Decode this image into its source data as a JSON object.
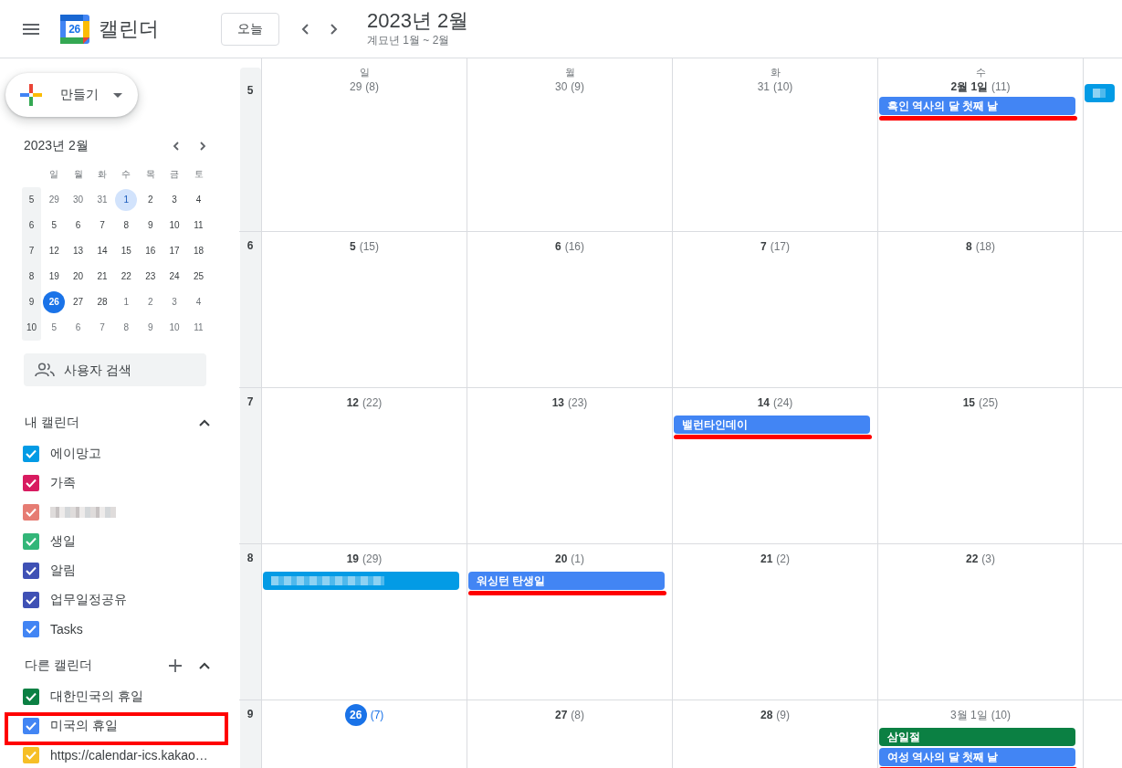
{
  "header": {
    "title": "캘린더",
    "logo_day": "26",
    "today_button": "오늘",
    "month_title": "2023년 2월",
    "lunar_subtitle": "계묘년 1월 ~ 2월"
  },
  "sidebar": {
    "create_button": "만들기",
    "mini_calendar": {
      "title": "2023년 2월",
      "weekdays": [
        "일",
        "월",
        "화",
        "수",
        "목",
        "금",
        "토"
      ],
      "weeks": [
        {
          "number": "5",
          "days": [
            {
              "label": "29",
              "outside": true,
              "today": false,
              "selected": false
            },
            {
              "label": "30",
              "outside": true,
              "today": false,
              "selected": false
            },
            {
              "label": "31",
              "outside": true,
              "today": false,
              "selected": false
            },
            {
              "label": "1",
              "outside": false,
              "today": false,
              "selected": true
            },
            {
              "label": "2",
              "outside": false,
              "today": false,
              "selected": false
            },
            {
              "label": "3",
              "outside": false,
              "today": false,
              "selected": false
            },
            {
              "label": "4",
              "outside": false,
              "today": false,
              "selected": false
            }
          ]
        },
        {
          "number": "6",
          "days": [
            {
              "label": "5",
              "outside": false,
              "today": false,
              "selected": false
            },
            {
              "label": "6",
              "outside": false,
              "today": false,
              "selected": false
            },
            {
              "label": "7",
              "outside": false,
              "today": false,
              "selected": false
            },
            {
              "label": "8",
              "outside": false,
              "today": false,
              "selected": false
            },
            {
              "label": "9",
              "outside": false,
              "today": false,
              "selected": false
            },
            {
              "label": "10",
              "outside": false,
              "today": false,
              "selected": false
            },
            {
              "label": "11",
              "outside": false,
              "today": false,
              "selected": false
            }
          ]
        },
        {
          "number": "7",
          "days": [
            {
              "label": "12",
              "outside": false,
              "today": false,
              "selected": false
            },
            {
              "label": "13",
              "outside": false,
              "today": false,
              "selected": false
            },
            {
              "label": "14",
              "outside": false,
              "today": false,
              "selected": false
            },
            {
              "label": "15",
              "outside": false,
              "today": false,
              "selected": false
            },
            {
              "label": "16",
              "outside": false,
              "today": false,
              "selected": false
            },
            {
              "label": "17",
              "outside": false,
              "today": false,
              "selected": false
            },
            {
              "label": "18",
              "outside": false,
              "today": false,
              "selected": false
            }
          ]
        },
        {
          "number": "8",
          "days": [
            {
              "label": "19",
              "outside": false,
              "today": false,
              "selected": false
            },
            {
              "label": "20",
              "outside": false,
              "today": false,
              "selected": false
            },
            {
              "label": "21",
              "outside": false,
              "today": false,
              "selected": false
            },
            {
              "label": "22",
              "outside": false,
              "today": false,
              "selected": false
            },
            {
              "label": "23",
              "outside": false,
              "today": false,
              "selected": false
            },
            {
              "label": "24",
              "outside": false,
              "today": false,
              "selected": false
            },
            {
              "label": "25",
              "outside": false,
              "today": false,
              "selected": false
            }
          ]
        },
        {
          "number": "9",
          "days": [
            {
              "label": "26",
              "outside": false,
              "today": true,
              "selected": false
            },
            {
              "label": "27",
              "outside": false,
              "today": false,
              "selected": false
            },
            {
              "label": "28",
              "outside": false,
              "today": false,
              "selected": false
            },
            {
              "label": "1",
              "outside": true,
              "today": false,
              "selected": false
            },
            {
              "label": "2",
              "outside": true,
              "today": false,
              "selected": false
            },
            {
              "label": "3",
              "outside": true,
              "today": false,
              "selected": false
            },
            {
              "label": "4",
              "outside": true,
              "today": false,
              "selected": false
            }
          ]
        },
        {
          "number": "10",
          "days": [
            {
              "label": "5",
              "outside": true,
              "today": false,
              "selected": false
            },
            {
              "label": "6",
              "outside": true,
              "today": false,
              "selected": false
            },
            {
              "label": "7",
              "outside": true,
              "today": false,
              "selected": false
            },
            {
              "label": "8",
              "outside": true,
              "today": false,
              "selected": false
            },
            {
              "label": "9",
              "outside": true,
              "today": false,
              "selected": false
            },
            {
              "label": "10",
              "outside": true,
              "today": false,
              "selected": false
            },
            {
              "label": "11",
              "outside": true,
              "today": false,
              "selected": false
            }
          ]
        }
      ]
    },
    "people_search": {
      "placeholder": "사용자 검색"
    },
    "calendar_groups": [
      {
        "title": "내 캘린더",
        "expanded": true,
        "addable": false,
        "items": [
          {
            "label": "에이망고",
            "color": "#039be5",
            "checked": true,
            "outlined": false
          },
          {
            "label": "가족",
            "color": "#d81b60",
            "checked": true,
            "outlined": false
          },
          {
            "redacted": true,
            "color": "#e67c73",
            "checked": true,
            "outlined": false
          },
          {
            "label": "생일",
            "color": "#33b679",
            "checked": true,
            "outlined": false
          },
          {
            "label": "알림",
            "color": "#3f51b5",
            "checked": true,
            "outlined": false
          },
          {
            "label": "업무일정공유",
            "color": "#3f51b5",
            "checked": true,
            "outlined": false
          },
          {
            "label": "Tasks",
            "color": "#4285f4",
            "checked": true,
            "outlined": false
          }
        ]
      },
      {
        "title": "다른 캘린더",
        "expanded": true,
        "addable": true,
        "items": [
          {
            "label": "대한민국의 휴일",
            "color": "#0b8043",
            "checked": true,
            "outlined": false
          },
          {
            "label": "미국의 휴일",
            "color": "#4285f4",
            "checked": true,
            "outlined": true
          },
          {
            "label": "https://calendar-ics.kakao…",
            "color": "#f6bf26",
            "checked": true,
            "outlined": false
          }
        ]
      }
    ]
  },
  "month": {
    "weekdays": [
      "일",
      "월",
      "화",
      "수"
    ],
    "weeks": [
      {
        "number": "5",
        "days": [
          {
            "date": "29",
            "lunar": "(8)",
            "kind": "outside"
          },
          {
            "date": "30",
            "lunar": "(9)",
            "kind": "outside"
          },
          {
            "date": "31",
            "lunar": "(10)",
            "kind": "outside"
          },
          {
            "date": "2월 1일",
            "lunar": "(11)",
            "kind": "current",
            "events": [
              {
                "title": "흑인 역사의 달 첫째 날",
                "color": "#4285f4",
                "underlined": true
              }
            ]
          },
          {
            "events": [
              {
                "redacted": true,
                "color": "#039be5"
              }
            ]
          }
        ]
      },
      {
        "number": "6",
        "days": [
          {
            "date": "5",
            "lunar": "(15)",
            "kind": "current"
          },
          {
            "date": "6",
            "lunar": "(16)",
            "kind": "current"
          },
          {
            "date": "7",
            "lunar": "(17)",
            "kind": "current"
          },
          {
            "date": "8",
            "lunar": "(18)",
            "kind": "current"
          }
        ]
      },
      {
        "number": "7",
        "days": [
          {
            "date": "12",
            "lunar": "(22)",
            "kind": "current"
          },
          {
            "date": "13",
            "lunar": "(23)",
            "kind": "current"
          },
          {
            "date": "14",
            "lunar": "(24)",
            "kind": "current",
            "events": [
              {
                "title": "밸런타인데이",
                "color": "#4285f4",
                "underlined": true
              }
            ]
          },
          {
            "date": "15",
            "lunar": "(25)",
            "kind": "current"
          }
        ]
      },
      {
        "number": "8",
        "days": [
          {
            "date": "19",
            "lunar": "(29)",
            "kind": "current",
            "events": [
              {
                "redacted": true,
                "color": "#039be5"
              }
            ]
          },
          {
            "date": "20",
            "lunar": "(1)",
            "kind": "current",
            "events": [
              {
                "title": "워싱턴 탄생일",
                "color": "#4285f4",
                "underlined": true
              }
            ]
          },
          {
            "date": "21",
            "lunar": "(2)",
            "kind": "current"
          },
          {
            "date": "22",
            "lunar": "(3)",
            "kind": "current"
          }
        ]
      },
      {
        "number": "9",
        "days": [
          {
            "date": "26",
            "lunar": "(7)",
            "kind": "today"
          },
          {
            "date": "27",
            "lunar": "(8)",
            "kind": "current"
          },
          {
            "date": "28",
            "lunar": "(9)",
            "kind": "current"
          },
          {
            "date": "3월 1일",
            "lunar": "(10)",
            "kind": "outside",
            "events": [
              {
                "title": "삼일절",
                "color": "#0b8043"
              },
              {
                "title": "여성 역사의 달 첫째 날",
                "color": "#4285f4",
                "underlined": true
              }
            ]
          }
        ]
      }
    ]
  }
}
